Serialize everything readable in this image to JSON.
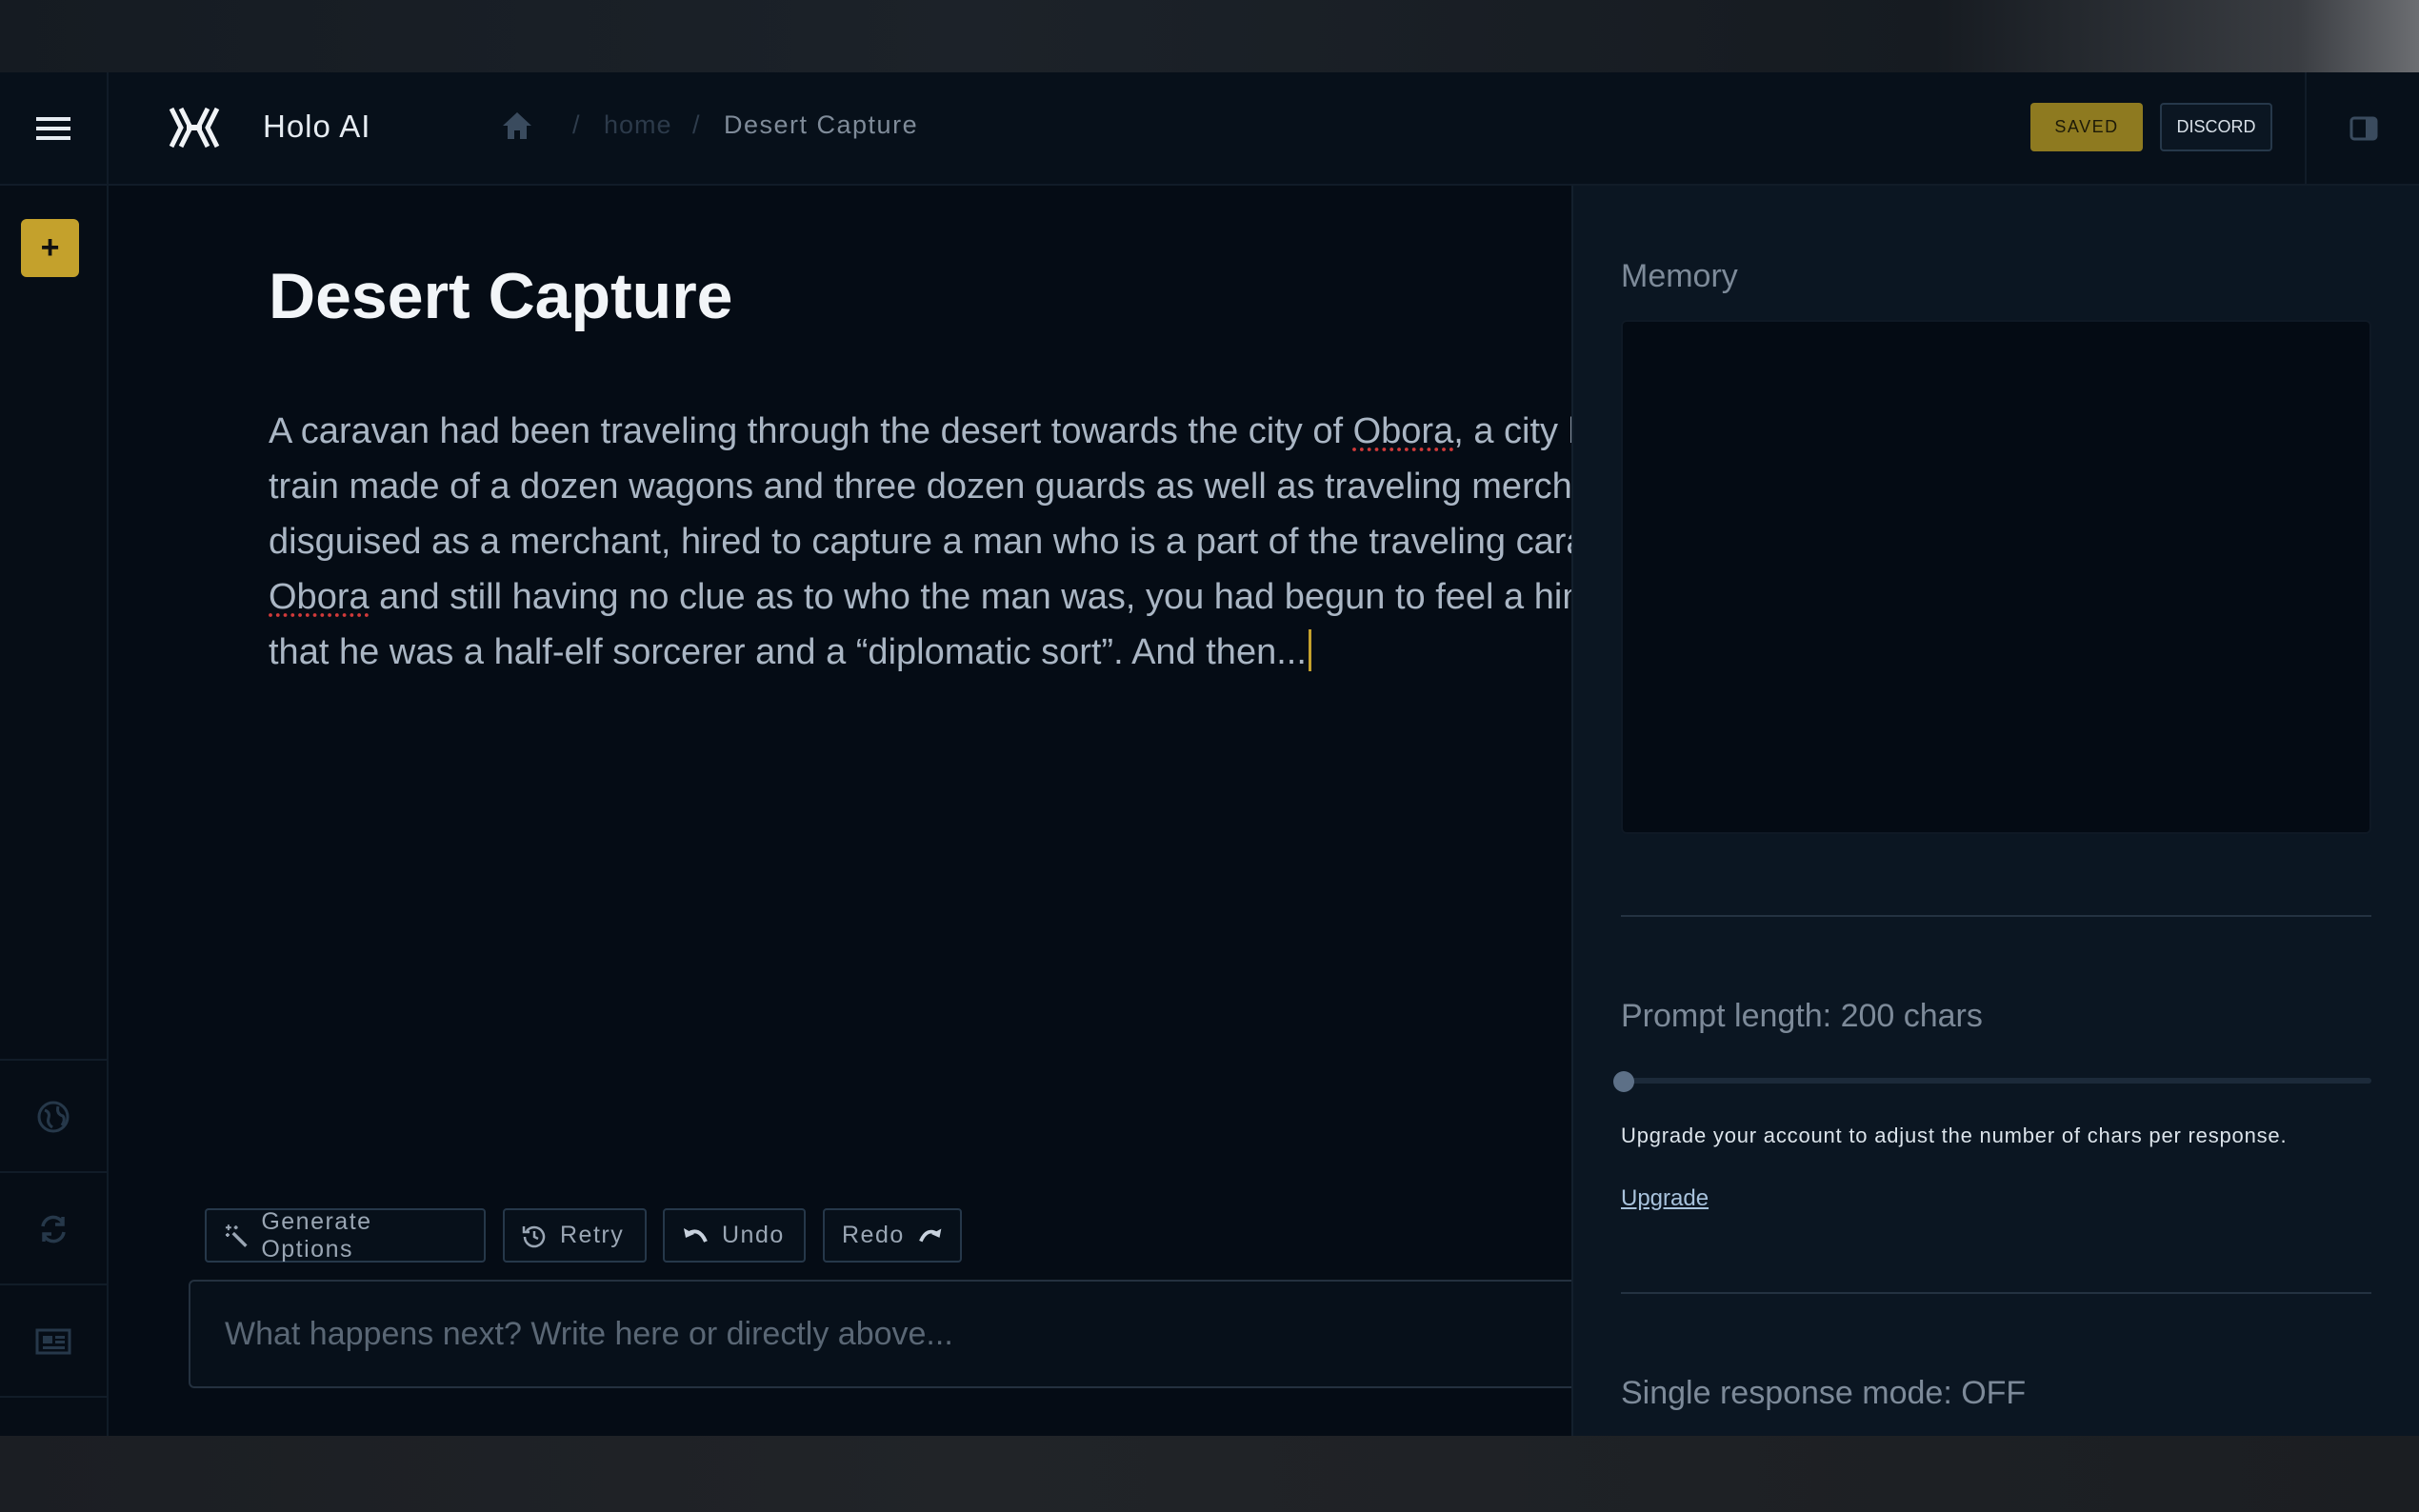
{
  "app": {
    "title": "Holo AI"
  },
  "breadcrumb": {
    "separator": "/",
    "home": "home",
    "current": "Desert Capture"
  },
  "header": {
    "saved_label": "SAVED",
    "discord_label": "DISCORD"
  },
  "rail": {
    "new_label": "+"
  },
  "story": {
    "title": "Desert Capture",
    "lines": [
      [
        "A caravan had been traveling through the desert towards the city of ",
        "Obora",
        ", a city b"
      ],
      [
        "train made of a dozen wagons and three dozen guards as well as traveling mercha"
      ],
      [
        "disguised as a merchant, hired to capture a man who is a part of the traveling cara"
      ],
      [
        "",
        "Obora",
        " and still having no clue as to who the man was, you had begun to feel a hint"
      ],
      [
        "that he was a half-elf sorcerer and a “diplomatic sort”. And then..."
      ]
    ]
  },
  "actions": {
    "generate": "Generate Options",
    "retry": "Retry",
    "undo": "Undo",
    "redo": "Redo"
  },
  "prompt": {
    "placeholder": "What happens next? Write here or directly above..."
  },
  "panel": {
    "memory_label": "Memory",
    "memory_value": "",
    "prompt_length_label": "Prompt length: 200 chars",
    "prompt_length_slider": {
      "value": 200,
      "fill_fraction": 0.0
    },
    "upgrade_note": "Upgrade your account to adjust the number of chars per response.",
    "upgrade_link": "Upgrade",
    "single_response_label": "Single response mode: OFF"
  },
  "icons": {
    "menu": "hamburger-icon",
    "logo": "holo-logo",
    "home": "home-icon",
    "panel": "panel-toggle-icon",
    "globe": "globe-icon",
    "sync": "sync-icon",
    "news": "news-icon",
    "help": "lifebuoy-icon",
    "generate": "magic-wand-icon",
    "retry": "history-icon",
    "undo": "undo-icon",
    "redo": "redo-icon"
  },
  "colors": {
    "accent": "#c4a12c",
    "saved": "#8e7a20",
    "background": "#050c15",
    "panel": "#0b1622"
  }
}
